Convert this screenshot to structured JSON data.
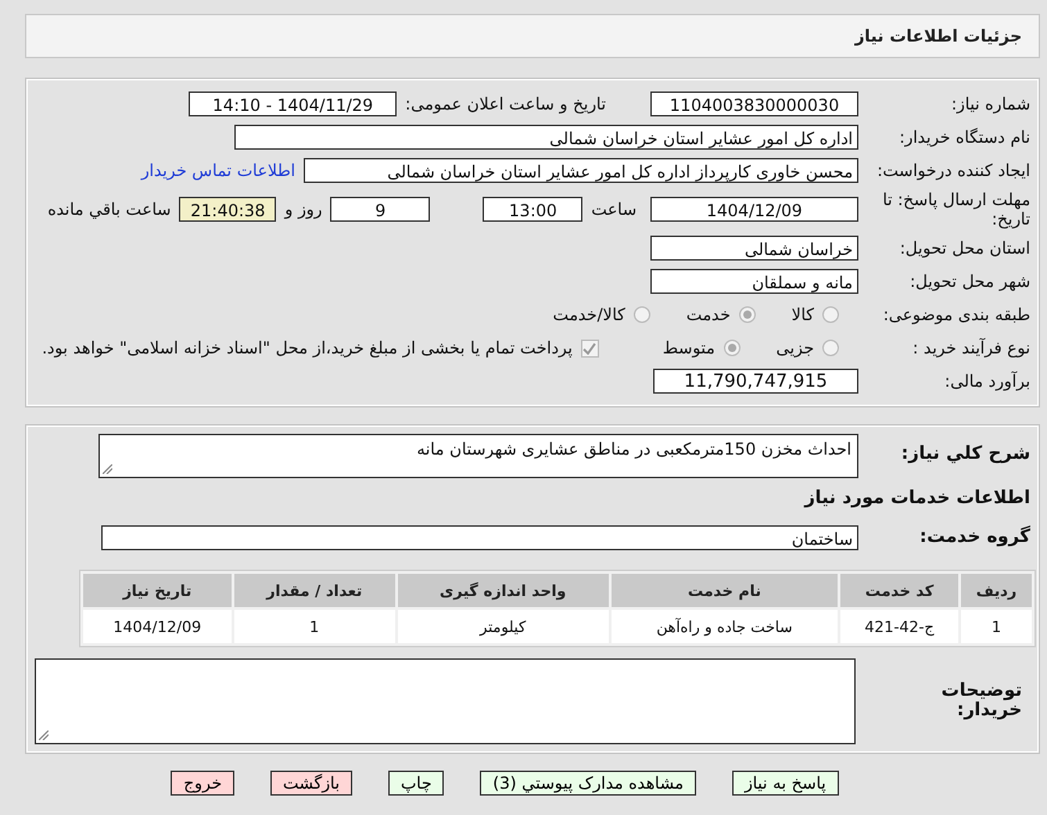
{
  "page_title": "جزئیات اطلاعات نیاز",
  "need_number": {
    "label": "شماره نیاز:",
    "value": "1104003830000030"
  },
  "announce": {
    "label": "تاریخ و ساعت اعلان عمومی:",
    "value": "1404/11/29 - 14:10"
  },
  "buyer_org": {
    "label": "نام دستگاه خریدار:",
    "value": "اداره کل امور عشایر استان خراسان شمالی"
  },
  "requester": {
    "label": "ایجاد کننده درخواست:",
    "value": "محسن خاوری کارپرداز اداره کل امور عشایر استان خراسان شمالی",
    "link": "اطلاعات تماس خریدار"
  },
  "deadline": {
    "label": "مهلت ارسال پاسخ: تا تاریخ:",
    "date": "1404/12/09",
    "time_label": "ساعت",
    "time": "13:00",
    "days": "9",
    "days_label": "روز و",
    "remaining": "21:40:38",
    "remaining_label": "ساعت باقي مانده"
  },
  "province": {
    "label": "استان محل تحویل:",
    "value": "خراسان شمالی"
  },
  "city": {
    "label": "شهر محل تحویل:",
    "value": "مانه و سملقان"
  },
  "category": {
    "label": "طبقه بندی موضوعی:",
    "options": [
      {
        "label": "کالا",
        "selected": false
      },
      {
        "label": "خدمت",
        "selected": true
      },
      {
        "label": "کالا/خدمت",
        "selected": false
      }
    ]
  },
  "process": {
    "label": "نوع فرآیند خرید :",
    "options": [
      {
        "label": "جزیی",
        "selected": false
      },
      {
        "label": "متوسط",
        "selected": true
      }
    ],
    "payment": {
      "checked": true,
      "text": "پرداخت تمام یا بخشی از مبلغ خرید،از محل \"اسناد خزانه اسلامی\" خواهد بود."
    }
  },
  "budget": {
    "label": "برآورد مالی:",
    "value": "11,790,747,915"
  },
  "description": {
    "label": "شرح کلي نیاز:",
    "value": "احداث مخزن 150مترمکعبی در مناطق عشایری شهرستان مانه"
  },
  "services_heading": "اطلاعات خدمات مورد نیاز",
  "service_group": {
    "label": "گروه خدمت:",
    "value": "ساختمان"
  },
  "table": {
    "columns": [
      "ردیف",
      "کد خدمت",
      "نام خدمت",
      "واحد اندازه گیری",
      "تعداد / مقدار",
      "تاریخ نیاز"
    ],
    "rows": [
      [
        "1",
        "ج-42-421",
        "ساخت جاده و راه‌آهن",
        "کیلومتر",
        "1",
        "1404/12/09"
      ]
    ]
  },
  "buyer_notes": {
    "label": "توضیحات خریدار:"
  },
  "buttons": [
    {
      "label": "پاسخ به نیاز",
      "kind": "normal"
    },
    {
      "label": "مشاهده مدارک پیوستي (3)",
      "kind": "normal"
    },
    {
      "label": "چاپ",
      "kind": "normal"
    },
    {
      "label": "بازگشت",
      "kind": "danger"
    },
    {
      "label": "خروج",
      "kind": "danger"
    }
  ]
}
